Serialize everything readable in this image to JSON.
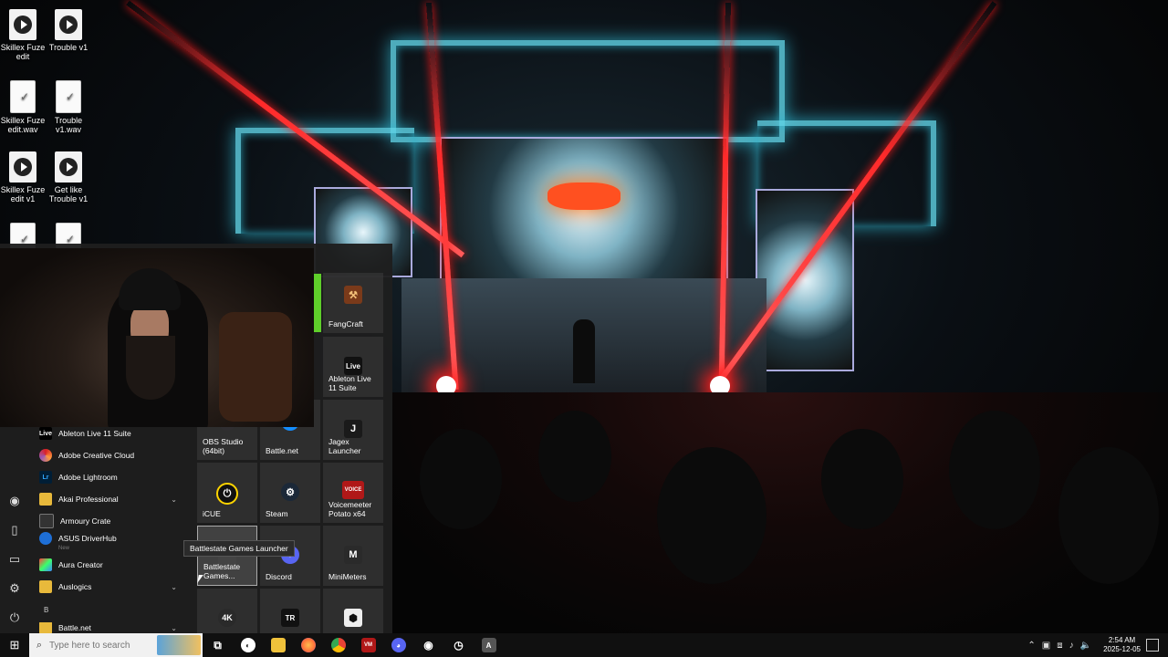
{
  "desktop_icons": [
    {
      "label": "Skillex Fuze edit",
      "kind": "media"
    },
    {
      "label": "Trouble v1",
      "kind": "media"
    },
    {
      "label": "Skillex Fuze edit.wav",
      "kind": "doc"
    },
    {
      "label": "Trouble v1.wav",
      "kind": "doc"
    },
    {
      "label": "Skillex Fuze edit v1",
      "kind": "media"
    },
    {
      "label": "Get like Trouble v1",
      "kind": "media"
    }
  ],
  "start_menu": {
    "app_list": [
      {
        "label": "Ableton Live 11 Suite",
        "icon": "ableton-icon",
        "icon_text": "Live",
        "color": "#000000"
      },
      {
        "label": "Adobe Creative Cloud",
        "icon": "creative-cloud-icon",
        "icon_text": "",
        "color": "#da1f26"
      },
      {
        "label": "Adobe Lightroom",
        "icon": "lightroom-icon",
        "icon_text": "Lr",
        "color": "#001e36"
      },
      {
        "label": "Akai Professional",
        "icon": "folder-icon",
        "icon_text": "",
        "color": "#e8b93b",
        "expandable": true
      },
      {
        "label": "Armoury Crate",
        "icon": "armoury-crate-icon",
        "icon_text": "",
        "color": "#333333"
      },
      {
        "label": "ASUS DriverHub",
        "icon": "asus-driverhub-icon",
        "icon_text": "",
        "color": "#1e6fd6",
        "sub": "New"
      },
      {
        "label": "Aura Creator",
        "icon": "aura-creator-icon",
        "icon_text": "",
        "color": "#222222"
      },
      {
        "label": "Auslogics",
        "icon": "folder-icon",
        "icon_text": "",
        "color": "#e8b93b",
        "expandable": true
      },
      {
        "label": "Battle.net",
        "icon": "folder-icon",
        "icon_text": "",
        "color": "#e8b93b",
        "expandable": true
      }
    ],
    "section_letter": "B",
    "tiles": [
      {
        "label": "FangCraft",
        "icon": "fangcraft-icon",
        "icon_text": "⚒",
        "color": "#7a3a1a"
      },
      {
        "label": "Ableton Live 11 Suite",
        "icon": "ableton-icon",
        "icon_text": "Live",
        "color": "#111111"
      },
      {
        "label": "OBS Studio (64bit)",
        "icon": "obs-icon",
        "icon_text": "◉",
        "color": "#302e31"
      },
      {
        "label": "Battle.net",
        "icon": "battlenet-icon",
        "icon_text": "✦",
        "color": "#148eff"
      },
      {
        "label": "Jagex Launcher",
        "icon": "jagex-icon",
        "icon_text": "J",
        "color": "#1a1a1a"
      },
      {
        "label": "iCUE",
        "icon": "icue-icon",
        "icon_text": "⏻",
        "color": "#111111"
      },
      {
        "label": "Steam",
        "icon": "steam-icon",
        "icon_text": "⚙",
        "color": "#1b2838"
      },
      {
        "label": "Voicemeeter Potato x64",
        "icon": "voicemeeter-icon",
        "icon_text": "VOICE",
        "color": "#b01818"
      },
      {
        "label": "Battlestate Games...",
        "icon": "battlestate-icon",
        "icon_text": "",
        "color": "#444444"
      },
      {
        "label": "Discord",
        "icon": "discord-icon",
        "icon_text": "◕",
        "color": "#5865f2"
      },
      {
        "label": "MiniMeters",
        "icon": "minimeters-icon",
        "icon_text": "M",
        "color": "#2a2a2a"
      },
      {
        "label": "",
        "icon": "4k-icon",
        "icon_text": "4K",
        "color": "#2a2a2a"
      },
      {
        "label": "",
        "icon": "tr-icon",
        "icon_text": "TR",
        "color": "#111111"
      },
      {
        "label": "",
        "icon": "hex-app-icon",
        "icon_text": "⬢",
        "color": "#eeeeee"
      }
    ],
    "tooltip": "Battlestate Games Launcher"
  },
  "taskbar": {
    "search_placeholder": "Type here to search",
    "pinned": [
      {
        "name": "task-view-icon",
        "text": "⧉",
        "color": "#101010"
      },
      {
        "name": "app-circle-icon",
        "text": "◐",
        "color": "#ffffff"
      },
      {
        "name": "file-explorer-icon",
        "text": "",
        "color": "#f0c23b"
      },
      {
        "name": "firefox-icon",
        "text": "",
        "color": "#ff7139"
      },
      {
        "name": "chrome-icon",
        "text": "",
        "color": "#34a853"
      },
      {
        "name": "voicemeeter-icon",
        "text": "VM",
        "color": "#b01818"
      },
      {
        "name": "discord-icon",
        "text": "◕",
        "color": "#5865f2"
      },
      {
        "name": "obs-icon",
        "text": "◉",
        "color": "#302e31"
      },
      {
        "name": "clock-app-icon",
        "text": "◷",
        "color": "#101010"
      },
      {
        "name": "ableton-icon",
        "text": "A",
        "color": "#555555"
      }
    ],
    "time": "2:54 AM",
    "date": "2025-12-05"
  }
}
